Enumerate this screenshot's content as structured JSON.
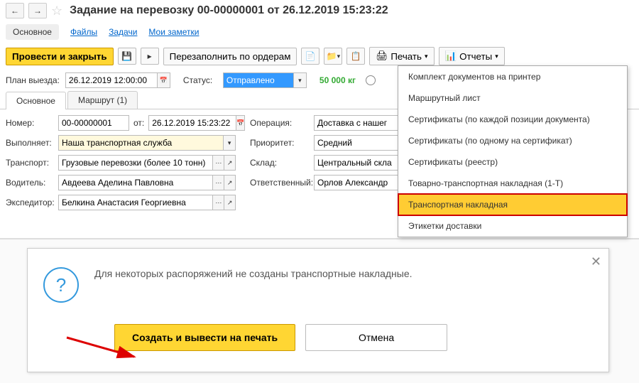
{
  "header": {
    "title": "Задание на перевозку 00-00000001 от 26.12.2019 15:23:22"
  },
  "links": {
    "main": "Основное",
    "files": "Файлы",
    "tasks": "Задачи",
    "notes": "Мои заметки"
  },
  "toolbar": {
    "post_close": "Провести и закрыть",
    "refill": "Перезаполнить по ордерам",
    "print": "Печать",
    "reports": "Отчеты"
  },
  "plan": {
    "label": "План выезда:",
    "date": "26.12.2019 12:00:00",
    "status_label": "Статус:",
    "status": "Отправлено",
    "weight": "50 000 кг"
  },
  "tabs": {
    "main": "Основное",
    "route": "Маршрут (1)"
  },
  "form": {
    "number_label": "Номер:",
    "number": "00-00000001",
    "from_label": "от:",
    "from": "26.12.2019 15:23:22",
    "operation_label": "Операция:",
    "operation": "Доставка с нашег",
    "executor_label": "Выполняет:",
    "executor": "Наша транспортная служба",
    "priority_label": "Приоритет:",
    "priority": "Средний",
    "transport_label": "Транспорт:",
    "transport": "Грузовые перевозки (более 10 тонн)",
    "warehouse_label": "Склад:",
    "warehouse": "Центральный скла",
    "driver_label": "Водитель:",
    "driver": "Авдеева Аделина Павловна",
    "responsible_label": "Ответственный:",
    "responsible": "Орлов Александр",
    "forwarder_label": "Экспедитор:",
    "forwarder": "Белкина Анастасия Георгиевна"
  },
  "dropdown": {
    "items": [
      "Комплект документов на принтер",
      "Маршрутный лист",
      "Сертификаты (по каждой позиции документа)",
      "Сертификаты (по одному на сертификат)",
      "Сертификаты (реестр)",
      "Товарно-транспортная накладная (1-Т)",
      "Транспортная накладная",
      "Этикетки доставки"
    ]
  },
  "dialog": {
    "message": "Для некоторых распоряжений не созданы транспортные накладные.",
    "create_print": "Создать и вывести на печать",
    "cancel": "Отмена"
  }
}
